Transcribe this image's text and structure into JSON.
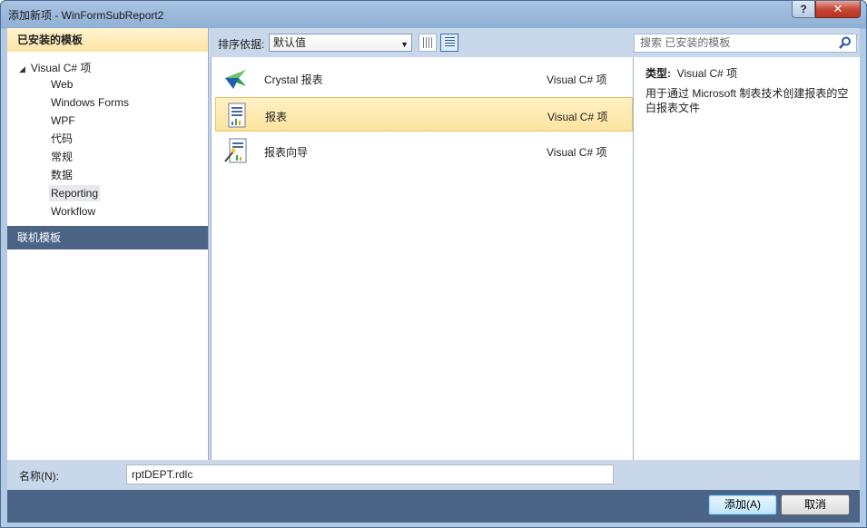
{
  "window": {
    "title": "添加新项 - WinFormSubReport2",
    "help_label": "?",
    "close_label": "✕"
  },
  "left": {
    "installed_header": "已安装的模板",
    "root": "Visual C# 项",
    "items": [
      "Web",
      "Windows Forms",
      "WPF",
      "代码",
      "常规",
      "数据",
      "Reporting",
      "Workflow"
    ],
    "selected_item": "Reporting",
    "online": "联机模板"
  },
  "toolbar": {
    "sort_label": "排序依据:",
    "sort_value": "默认值"
  },
  "templates": [
    {
      "name": "Crystal 报表",
      "type": "Visual C# 项",
      "icon": "crystal-report-icon"
    },
    {
      "name": "报表",
      "type": "Visual C# 项",
      "icon": "report-icon",
      "selected": true
    },
    {
      "name": "报表向导",
      "type": "Visual C# 项",
      "icon": "report-wizard-icon"
    }
  ],
  "search": {
    "placeholder": "搜索 已安装的模板"
  },
  "details": {
    "type_label": "类型:",
    "type_value": "Visual C# 项",
    "description": "用于通过 Microsoft 制表技术创建报表的空白报表文件"
  },
  "bottom": {
    "name_label": "名称(N):",
    "name_value": "rptDEPT.rdlc",
    "add_label": "添加(A)",
    "cancel_label": "取消"
  },
  "colors": {
    "selection": "#fde59f",
    "nav_dark": "#4c6587",
    "header_gold": "#fde4a5"
  }
}
